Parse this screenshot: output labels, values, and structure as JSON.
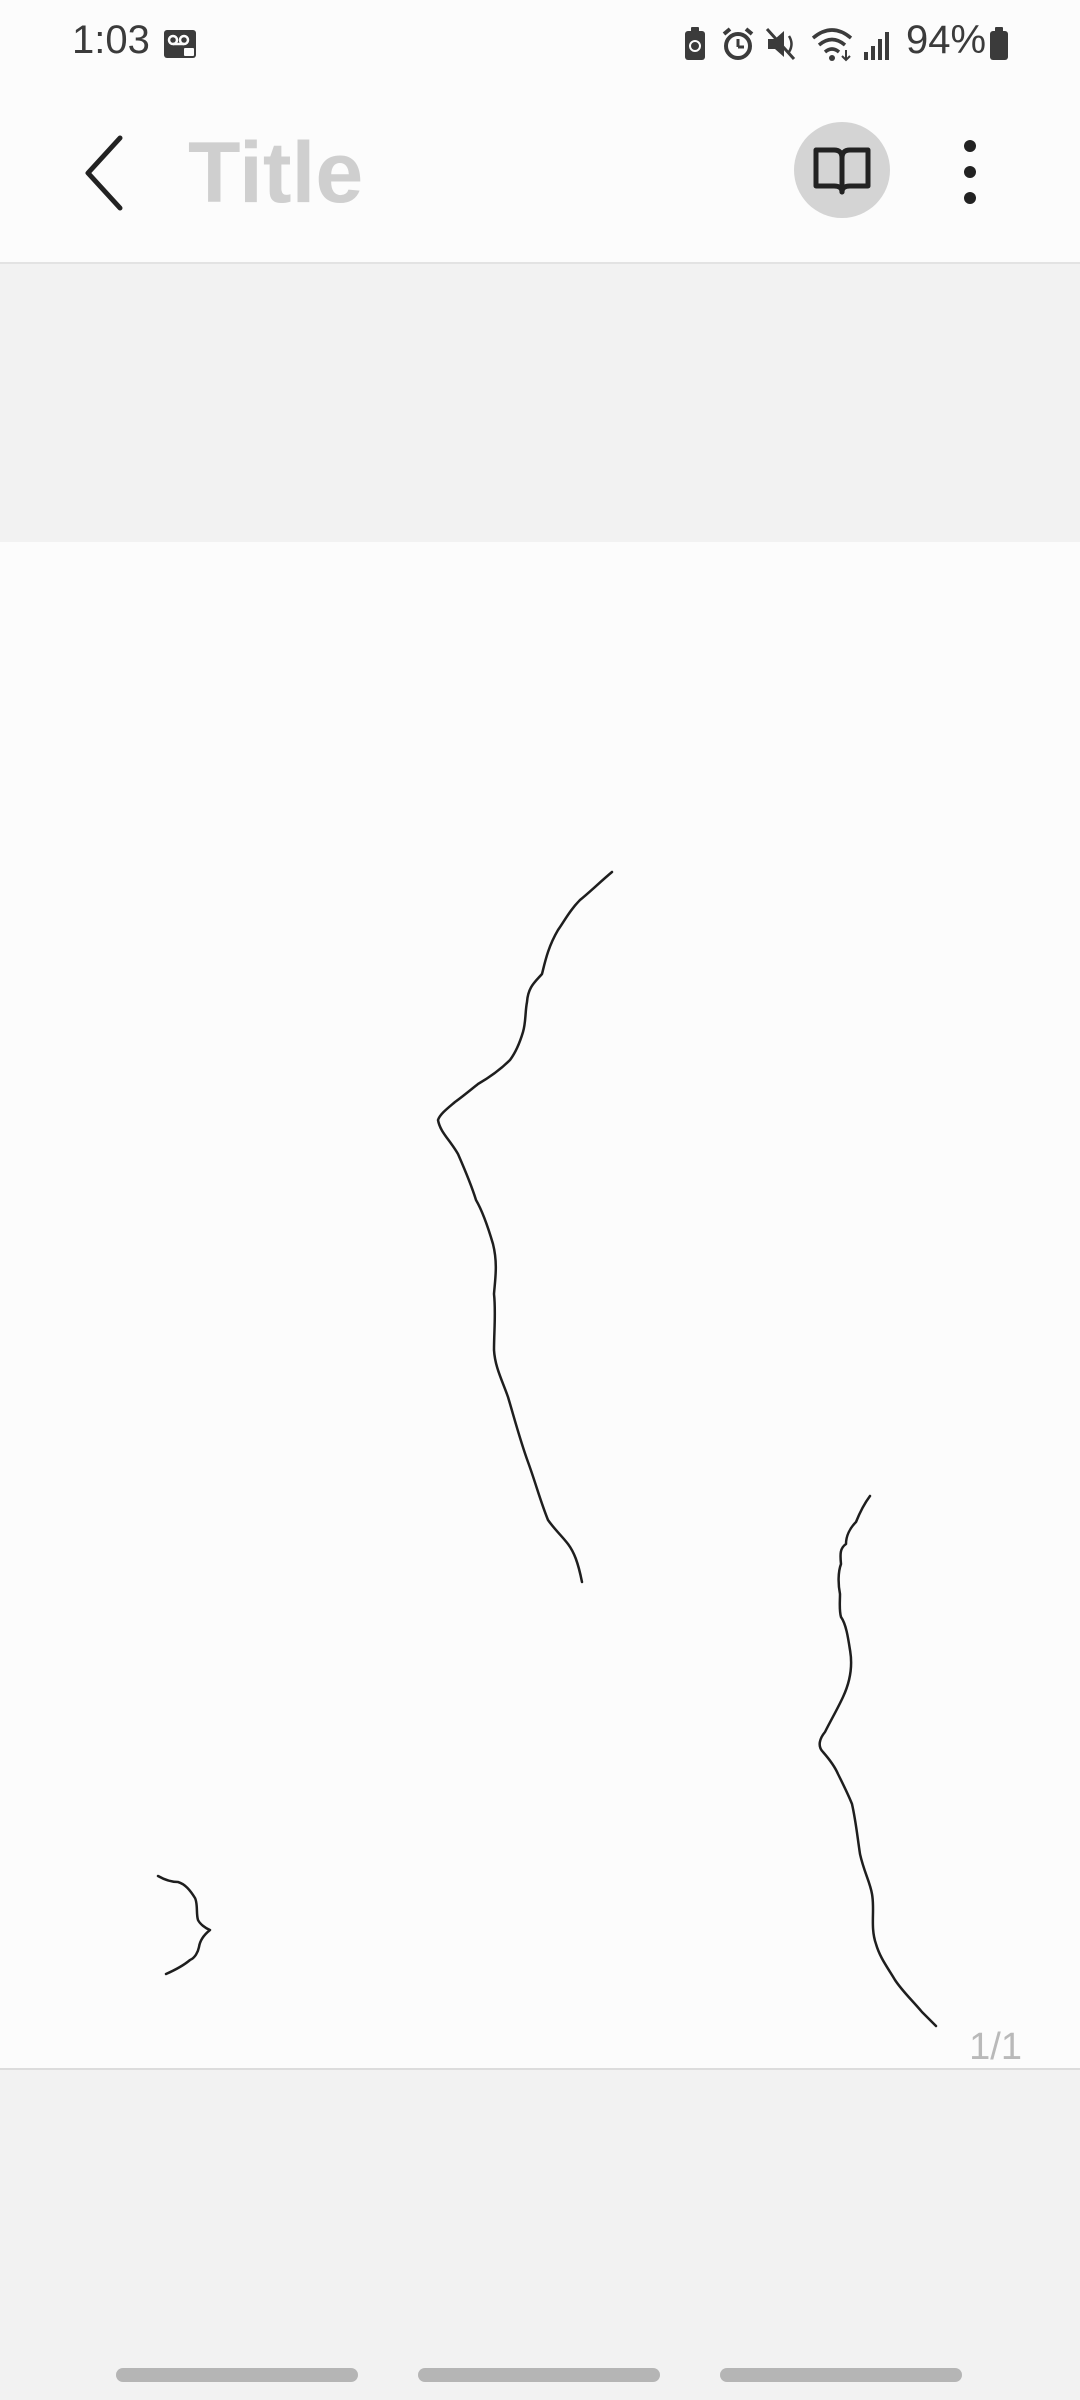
{
  "status_bar": {
    "time": "1:03",
    "battery_percent": "94%",
    "icons": [
      "voicemail-icon",
      "battery-saver-icon",
      "alarm-icon",
      "mute-icon",
      "wifi-icon",
      "signal-icon",
      "battery-icon"
    ]
  },
  "app_bar": {
    "title": "Title",
    "back_icon": "chevron-left-icon",
    "reading_mode_icon": "book-open-icon",
    "more_icon": "more-vertical-icon"
  },
  "canvas": {
    "page_indicator": "1/1",
    "stroke_color": "#1e1e1e"
  },
  "colors": {
    "background": "#fcfcfc",
    "band": "#f2f2f2",
    "title_placeholder": "#cfcfcf",
    "icon": "#222222"
  }
}
